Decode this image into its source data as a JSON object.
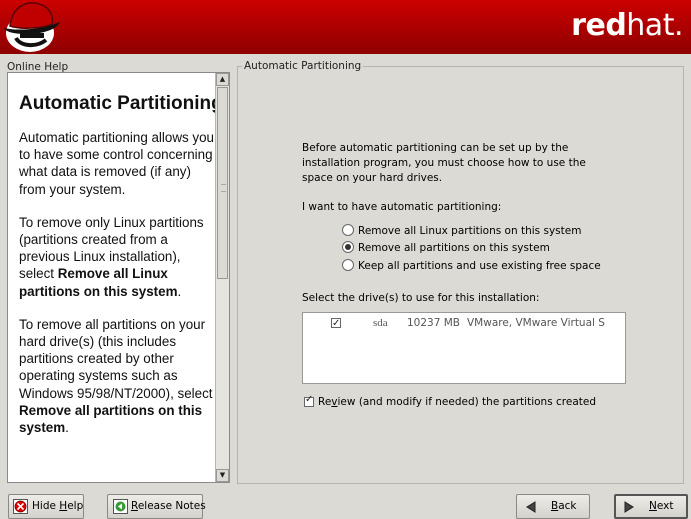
{
  "header": {
    "brand_bold": "red",
    "brand_light": "hat."
  },
  "help": {
    "label": "Online Help",
    "title": "Automatic Partitioning",
    "p1": "Automatic partitioning allows you to have some control concerning what data is removed (if any) from your system.",
    "p2_text": "To remove only Linux partitions (partitions created from a previous Linux installation), select ",
    "p2_bold": "Remove all Linux partitions on this system",
    "p2_end": ".",
    "p3_text": "To remove all partitions on your hard drive(s) (this includes partitions created by other operating systems such as Windows 95/98/NT/2000), select ",
    "p3_bold": "Remove all partitions on this system",
    "p3_end": "."
  },
  "main": {
    "legend": "Automatic Partitioning",
    "intro": "Before automatic partitioning can be set up by the installation program, you must choose how to use the space on your hard drives.",
    "want_label": "I want to have automatic partitioning:",
    "options": [
      {
        "label": "Remove all Linux partitions on this system",
        "selected": false
      },
      {
        "label": "Remove all partitions on this system",
        "selected": true
      },
      {
        "label": "Keep all partitions and use existing free space",
        "selected": false
      }
    ],
    "drives_label": "Select the drive(s) to use for this installation:",
    "drives": [
      {
        "checked": true,
        "device": "sda",
        "size": "10237 MB",
        "model": "VMware, VMware Virtual S"
      }
    ],
    "review_label_pre": "Re",
    "review_label_u": "v",
    "review_label_post": "iew (and modify if needed) the partitions created",
    "review_checked": true
  },
  "buttons": {
    "hide_help_pre": "Hide ",
    "hide_help_u": "H",
    "hide_help_post": "elp",
    "release_u": "R",
    "release_post": "elease Notes",
    "back_u": "B",
    "back_post": "ack",
    "next_u": "N",
    "next_post": "ext"
  },
  "colors": {
    "banner_red": "#b00000",
    "window_bg": "#dcdad5"
  }
}
